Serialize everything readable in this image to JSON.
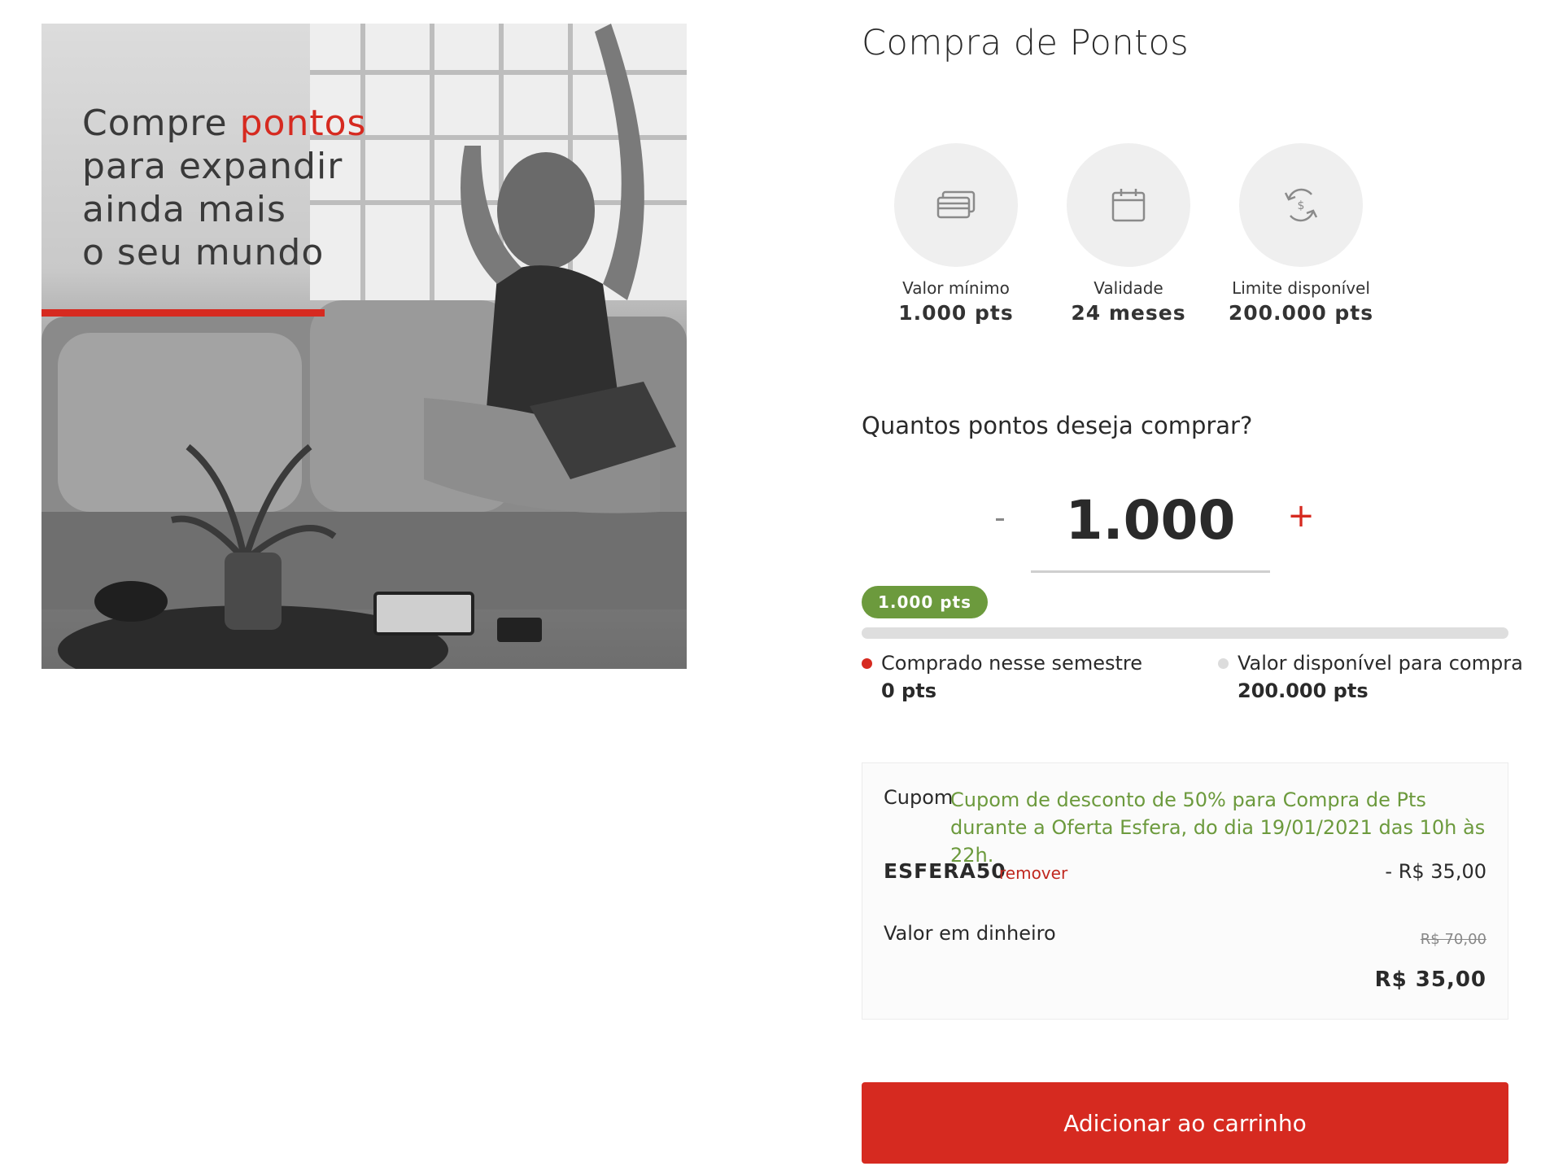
{
  "promo": {
    "headline_lines": [
      "Compre ",
      "pontos",
      "para expandir",
      "ainda mais",
      "o seu mundo"
    ],
    "accent_color": "#d62a20"
  },
  "header": {
    "title": "Compra de Pontos"
  },
  "features": [
    {
      "icon": "cards-icon",
      "label": "Valor mínimo",
      "value": "1.000 pts"
    },
    {
      "icon": "calendar-icon",
      "label": "Validade",
      "value": "24 meses"
    },
    {
      "icon": "money-exchange-icon",
      "label": "Limite disponível",
      "value": "200.000 pts"
    }
  ],
  "purchase": {
    "question": "Quantos pontos deseja comprar?",
    "minus_label": "-",
    "quantity": "1.000",
    "plus_label": "+",
    "badge": "1.000 pts",
    "progress_fraction": 0.0
  },
  "legend": {
    "bought_label": "Comprado nesse semestre",
    "bought_value": "0 pts",
    "available_label": "Valor disponível para compra",
    "available_value": "200.000 pts"
  },
  "coupon": {
    "label": "Cupom",
    "description": "Cupom de desconto de 50% para Compra de Pts durante a Oferta Esfera, do dia 19/01/2021 das 10h às 22h.",
    "code": "ESFERA50",
    "remove_label": "remover",
    "discount": "- R$ 35,00",
    "cash_label": "Valor em dinheiro",
    "original_price": "R$ 70,00",
    "final_price": "R$ 35,00"
  },
  "actions": {
    "add_to_cart": "Adicionar ao carrinho"
  },
  "colors": {
    "brand_red": "#d62a20",
    "success_green": "#6c9a3d",
    "circle_gray": "#efefef"
  }
}
